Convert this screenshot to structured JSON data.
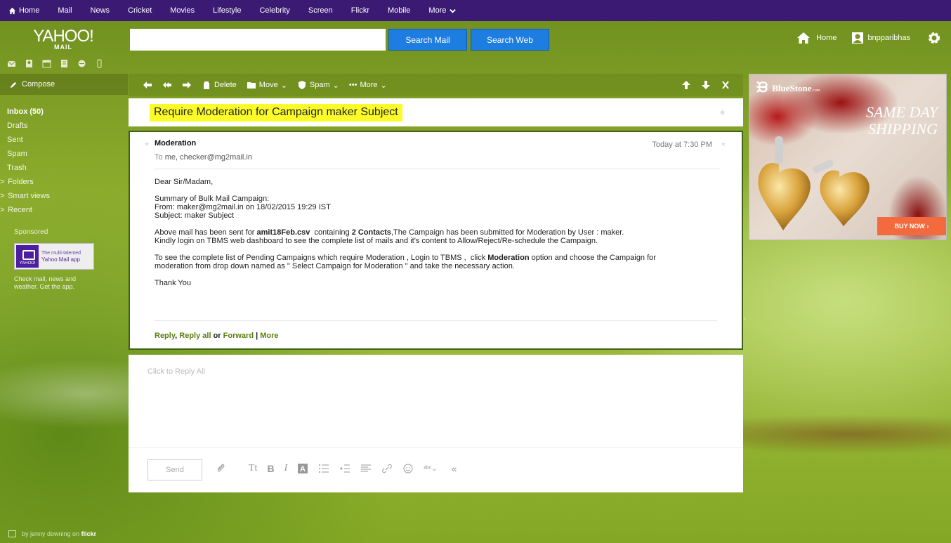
{
  "topnav": {
    "items": [
      "Home",
      "Mail",
      "News",
      "Cricket",
      "Movies",
      "Lifestyle",
      "Celebrity",
      "Screen",
      "Flickr",
      "Mobile",
      "More"
    ]
  },
  "logo": {
    "main": "YAHOO!",
    "sub": "MAIL"
  },
  "search": {
    "placeholder": "",
    "value": "",
    "mail_button": "Search Mail",
    "web_button": "Search Web"
  },
  "header_right": {
    "home_label": "Home",
    "username": "bnpparibhas"
  },
  "sidebar": {
    "compose_label": "Compose",
    "folders": [
      {
        "label": "Inbox (50)",
        "caret": ""
      },
      {
        "label": "Drafts",
        "caret": ""
      },
      {
        "label": "Sent",
        "caret": ""
      },
      {
        "label": "Spam",
        "caret": ""
      },
      {
        "label": "Trash",
        "caret": ""
      },
      {
        "label": "Folders",
        "caret": ">"
      },
      {
        "label": "Smart views",
        "caret": ">"
      },
      {
        "label": "Recent",
        "caret": ">"
      }
    ],
    "sponsored_label": "Sponsored",
    "sponsored_ad": {
      "line1": "The multi-talented",
      "line2": "Yahoo Mail app",
      "logo_text": "YAHOO!"
    },
    "sponsored_desc": "Check mail, news and weather. Get the app.",
    "footer_prefix": "by jenny downing on",
    "footer_brand": "flickr"
  },
  "toolbar": {
    "delete_label": "Delete",
    "move_label": "Move",
    "spam_label": "Spam",
    "more_label": "More"
  },
  "message": {
    "subject": "Require Moderation for Campaign maker Subject",
    "sender": "Moderation",
    "time": "Today at 7:30 PM",
    "to_label": "To",
    "to_value": "me, checker@mg2mail.in",
    "greeting": "Dear Sir/Madam,",
    "summary_1": "Summary of Bulk Mail Campaign:",
    "summary_2": "From: maker@mg2mail.in on 18/02/2015 19:29 IST",
    "summary_3": "Subject: maker Subject",
    "para1_a": "Above mail has been sent for ",
    "para1_file": "amit18Feb.csv",
    "para1_b": "  containing ",
    "para1_contacts": "2 Contacts",
    "para1_c": ",The Campaign has been submitted for Moderation by User : maker.",
    "para1_d": "Kindly login on TBMS web dashboard to see the complete list of mails and it's content to Allow/Reject/Re-schedule the Campaign.",
    "para2_a": "To see the complete list of Pending Campaigns which require Moderation , Login to TBMS ,  click ",
    "para2_bold": "Moderation",
    "para2_b": " option and choose the Campaign for",
    "para2_c": "moderation from drop down named as \" Select Campaign for Moderation \" and take the necessary action.",
    "closing": "Thank You",
    "reply_label": "Reply",
    "comma": ",",
    "reply_all_label": "Reply all",
    "or_label": "or",
    "forward_label": "Forward",
    "sep_label": "|",
    "more_label": "More"
  },
  "reply": {
    "placeholder": "Click to Reply All",
    "send_label": "Send",
    "icons": [
      "attach-icon",
      "text-size-icon",
      "bold-icon",
      "italic-icon",
      "text-color-icon",
      "bullet-list-icon",
      "indent-icon",
      "align-icon",
      "link-icon",
      "emoji-icon",
      "spellcheck-icon",
      "collapse-toolbar-icon"
    ]
  },
  "ad": {
    "brand": "BlueStone",
    "brand_suffix": ".com",
    "headline_1": "SAME DAY",
    "headline_2": "SHIPPING",
    "cta": "BUY NOW ›"
  },
  "colors": {
    "topnav": "#3a1a73",
    "search_button": "#1d7de0",
    "highlight": "#fcfb2a",
    "link_green": "#5a7f0f",
    "ad_cta": "#f26a3d"
  }
}
